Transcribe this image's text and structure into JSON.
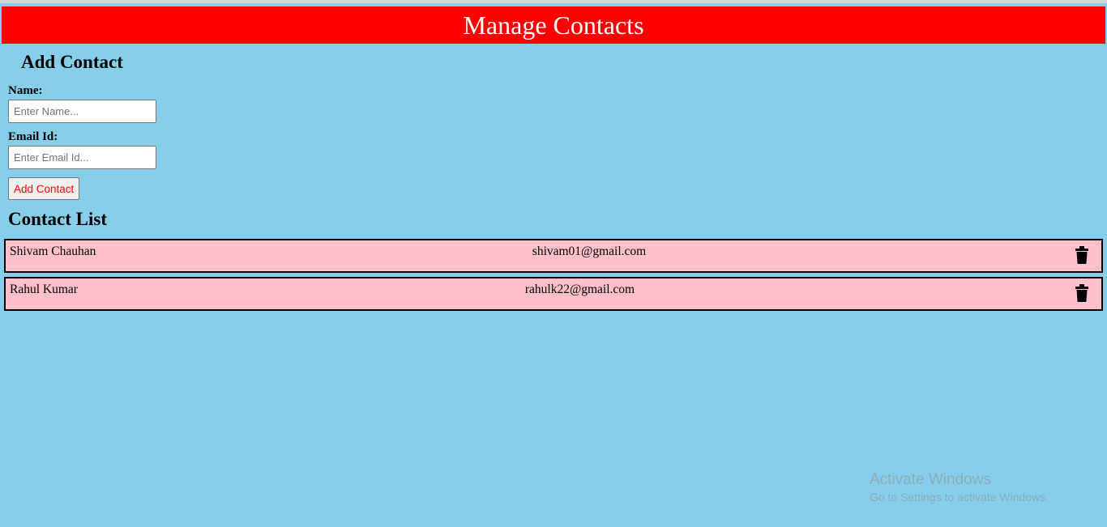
{
  "header": {
    "title": "Manage Contacts"
  },
  "add_form": {
    "title": "Add Contact",
    "name_label": "Name:",
    "name_placeholder": "Enter Name...",
    "name_value": "",
    "email_label": "Email Id:",
    "email_placeholder": "Enter Email Id...",
    "email_value": "",
    "submit_label": "Add Contact"
  },
  "contact_list": {
    "title": "Contact List",
    "items": [
      {
        "name": "Shivam Chauhan",
        "email": "shivam01@gmail.com",
        "delete_icon": "trash-icon"
      },
      {
        "name": "Rahul Kumar",
        "email": "rahulk22@gmail.com",
        "delete_icon": "trash-icon"
      }
    ]
  },
  "watermark": {
    "title": "Activate Windows",
    "subtitle": "Go to Settings to activate Windows."
  },
  "colors": {
    "header_bg": "#ff0000",
    "page_bg": "#87ceeb",
    "item_bg": "#ffc0cb",
    "button_text": "#ff0000"
  }
}
